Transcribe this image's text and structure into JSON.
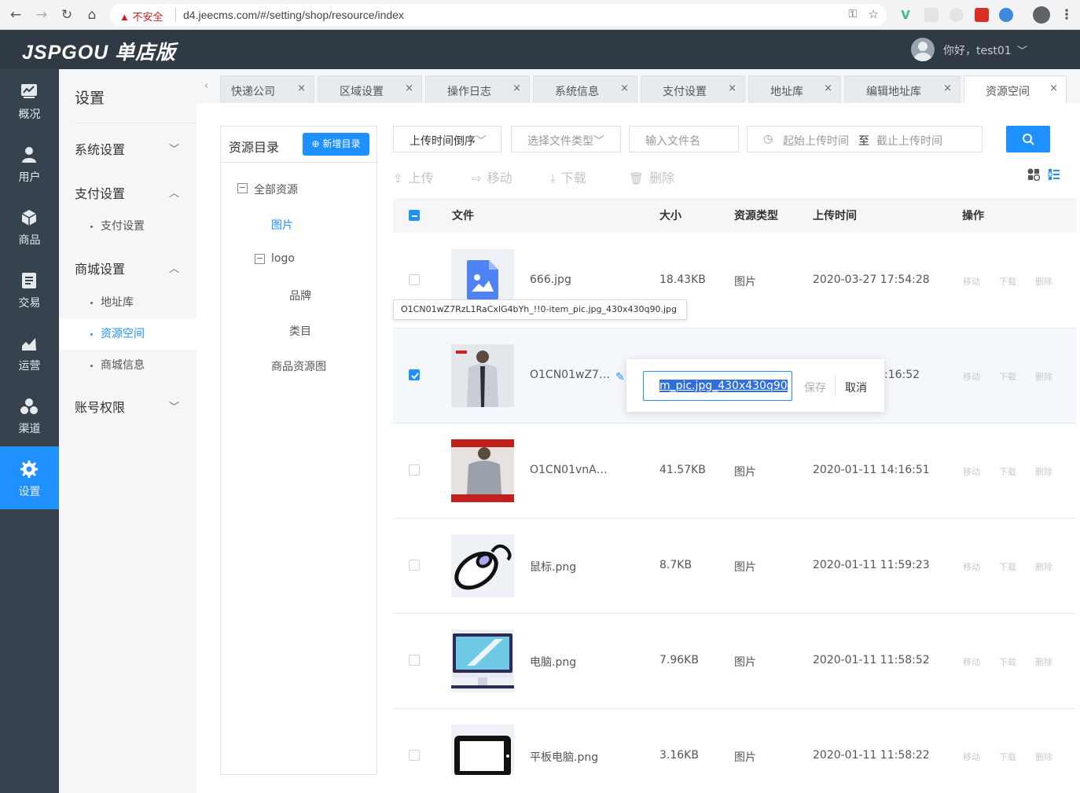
{
  "browser": {
    "insecure_label": "不安全",
    "url": "d4.jeecms.com/#/setting/shop/resource/index"
  },
  "header": {
    "logo": "JSPGOU 单店版",
    "greeting": "你好，test01"
  },
  "nav": [
    {
      "label": "概况",
      "icon": "chart-icon"
    },
    {
      "label": "用户",
      "icon": "user-icon"
    },
    {
      "label": "商品",
      "icon": "cube-icon"
    },
    {
      "label": "交易",
      "icon": "list-icon"
    },
    {
      "label": "运营",
      "icon": "trend-icon"
    },
    {
      "label": "渠道",
      "icon": "channel-icon"
    },
    {
      "label": "设置",
      "icon": "gear-icon",
      "active": true
    }
  ],
  "submenu": {
    "title": "设置",
    "groups": {
      "system": "系统设置",
      "pay": "支付设置",
      "pay_item": "支付设置",
      "mall": "商城设置",
      "mall_item1": "地址库",
      "mall_item2": "资源空间",
      "mall_item3": "商城信息",
      "account": "账号权限"
    }
  },
  "tabs": [
    "快递公司",
    "区域设置",
    "操作日志",
    "系统信息",
    "支付设置",
    "地址库",
    "编辑地址库",
    "资源空间"
  ],
  "tree": {
    "title": "资源目录",
    "new_button": "新增目录",
    "all": "全部资源",
    "image": "图片",
    "logo": "logo",
    "brand": "品牌",
    "category": "类目",
    "goods": "商品资源图"
  },
  "filters": {
    "sort": "上传时间倒序",
    "type": "选择文件类型",
    "name_placeholder": "输入文件名",
    "start_placeholder": "起始上传时间",
    "to": "至",
    "end_placeholder": "截止上传时间"
  },
  "toolbar": {
    "upload": "上传",
    "move": "移动",
    "download": "下载",
    "delete": "删除"
  },
  "table": {
    "headers": {
      "file": "文件",
      "size": "大小",
      "type": "资源类型",
      "time": "上传时间",
      "ops": "操作"
    },
    "op_move": "移动",
    "op_download": "下载",
    "op_delete": "删除",
    "rows": [
      {
        "name": "666.jpg",
        "size": "18.43KB",
        "type": "图片",
        "time": "2020-03-27 17:54:28",
        "checked": false
      },
      {
        "name": "O1CN01wZ7…",
        "size": "",
        "type": "",
        "time": ":16:52",
        "checked": true
      },
      {
        "name": "O1CN01vnA…",
        "size": "41.57KB",
        "type": "图片",
        "time": "2020-01-11 14:16:51",
        "checked": false
      },
      {
        "name": "鼠标.png",
        "size": "8.7KB",
        "type": "图片",
        "time": "2020-01-11 11:59:23",
        "checked": false
      },
      {
        "name": "电脑.png",
        "size": "7.96KB",
        "type": "图片",
        "time": "2020-01-11 11:58:52",
        "checked": false
      },
      {
        "name": "平板电脑.png",
        "size": "3.16KB",
        "type": "图片",
        "time": "2020-01-11 11:58:22",
        "checked": false
      }
    ]
  },
  "tooltip": "O1CN01wZ7RzL1RaCxlG4bYh_!!0-item_pic.jpg_430x430q90.jpg",
  "rename": {
    "value": "m_pic.jpg_430x430q90",
    "save": "保存",
    "cancel": "取消"
  },
  "colors": {
    "accent": "#1e90ff",
    "header": "#2f3a45",
    "nav": "#36424e"
  }
}
